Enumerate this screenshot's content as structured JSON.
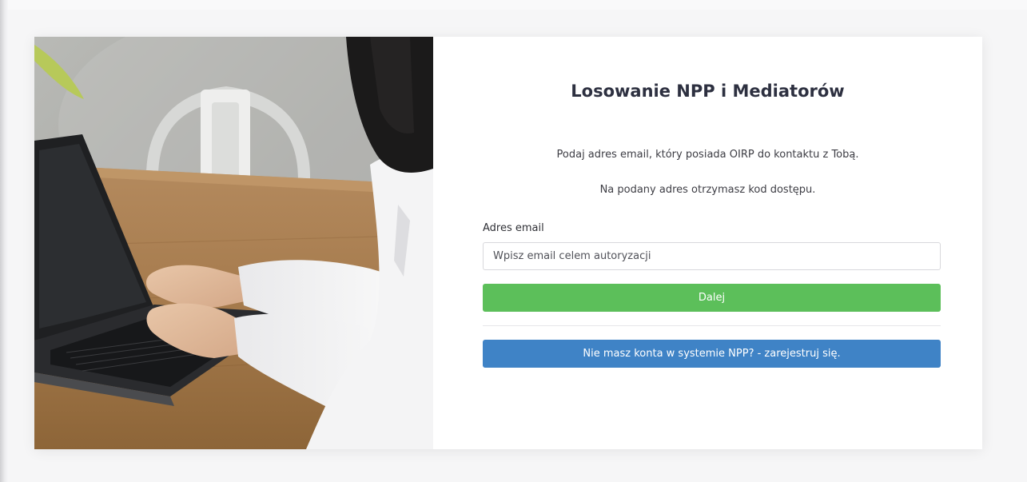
{
  "form": {
    "title": "Losowanie NPP i Mediatorów",
    "info_line_1": "Podaj adres email, który posiada OIRP do kontaktu z Tobą.",
    "info_line_2": "Na podany adres otrzymasz kod dostępu.",
    "email_label": "Adres email",
    "email_value": "",
    "email_placeholder": "Wpisz email celem autoryzacji",
    "next_button_label": "Dalej",
    "register_button_label": "Nie masz konta w systemie NPP? - zarejestruj się."
  },
  "colors": {
    "next_button": "#5cbf5a",
    "register_button": "#3f83c6",
    "title_text": "#2d3040"
  },
  "photo": {
    "subject": "person-typing-on-laptop-photo"
  }
}
